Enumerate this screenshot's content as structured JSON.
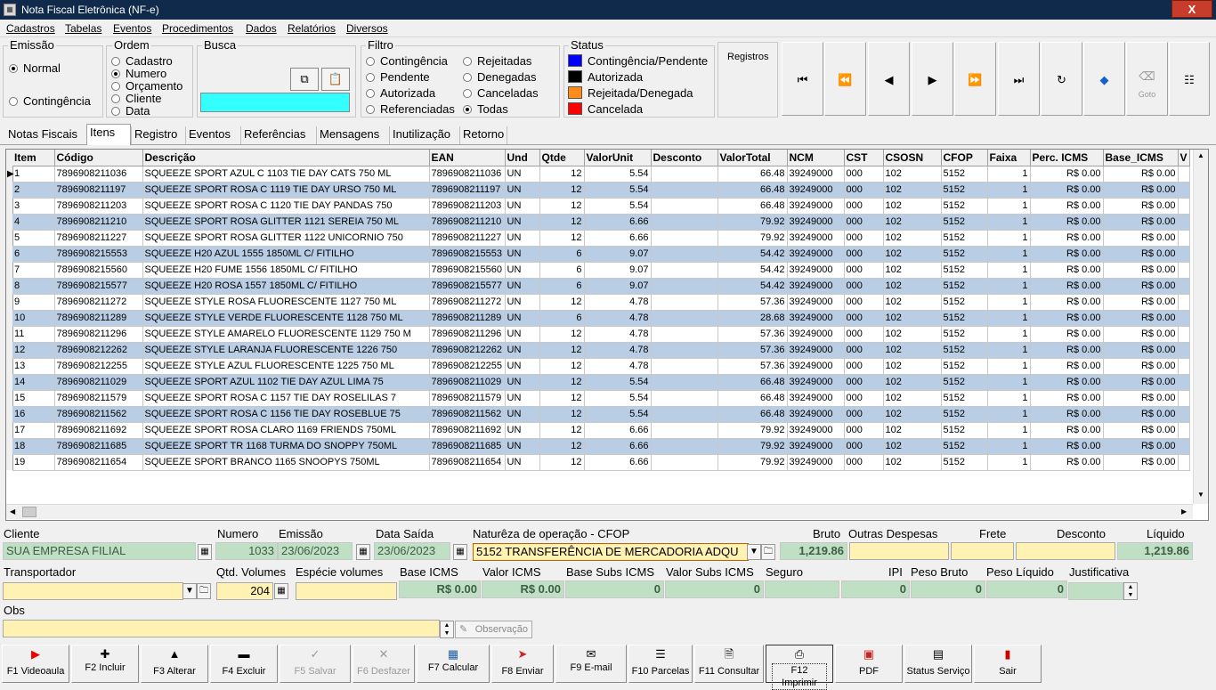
{
  "window": {
    "title": "Nota Fiscal Eletrônica (NF-e)",
    "close_glyph": "X",
    "min_glyph": "—",
    "max_glyph": "□"
  },
  "menu": [
    "Cadastros",
    "Tabelas",
    "Eventos",
    "Procedimentos",
    "Dados",
    "Relatórios",
    "Diversos"
  ],
  "emissao": {
    "label": "Emissão",
    "options": [
      "Normal",
      "Contingência"
    ],
    "selected": "Normal"
  },
  "ordem": {
    "label": "Ordem",
    "options": [
      "Cadastro",
      "Numero",
      "Orçamento",
      "Cliente",
      "Data"
    ],
    "selected": "Numero"
  },
  "busca": {
    "label": "Busca",
    "value": ""
  },
  "filtro": {
    "label": "Filtro",
    "options": [
      "Contingência",
      "Rejeitadas",
      "Pendente",
      "Denegadas",
      "Autorizada",
      "Canceladas",
      "Referenciadas",
      "Todas"
    ],
    "selected": "Todas"
  },
  "status": {
    "label": "Status",
    "items": [
      {
        "label": "Contingência/Pendente",
        "color": "#0000ff"
      },
      {
        "label": "Autorizada",
        "color": "#000000"
      },
      {
        "label": "Rejeitada/Denegada",
        "color": "#ff8c1a"
      },
      {
        "label": "Cancelada",
        "color": "#ff0000"
      }
    ]
  },
  "registros_label": "Registros",
  "toolbar_icons": [
    "first-icon",
    "prev-page-icon",
    "prev-icon",
    "next-icon",
    "next-page-icon",
    "last-icon",
    "refresh-icon",
    "bookmark-icon",
    "goto-icon",
    "list-icon"
  ],
  "toolbar_goto_label": "Goto",
  "tabs": [
    "Notas Fiscais",
    "Itens",
    "Registro",
    "Eventos",
    "Referências",
    "Mensagens",
    "Inutilização",
    "Retorno"
  ],
  "active_tab": "Itens",
  "grid": {
    "columns": [
      "Item",
      "Código",
      "Descrição",
      "EAN",
      "Und",
      "Qtde",
      "ValorUnit",
      "Desconto",
      "ValorTotal",
      "NCM",
      "CST",
      "CSOSN",
      "CFOP",
      "Faixa",
      "Perc. ICMS",
      "Base_ICMS",
      "V"
    ],
    "rows": [
      [
        "1",
        "7896908211036",
        "SQUEEZE SPORT AZUL C 1103 TIE DAY CATS 750 ML",
        "7896908211036",
        "UN",
        "12",
        "5.54",
        "",
        "66.48",
        "39249000",
        "000",
        "102",
        "5152",
        "1",
        "R$ 0.00",
        "R$ 0.00"
      ],
      [
        "2",
        "7896908211197",
        "SQUEEZE SPORT ROSA C 1119 TIE DAY URSO 750 ML",
        "7896908211197",
        "UN",
        "12",
        "5.54",
        "",
        "66.48",
        "39249000",
        "000",
        "102",
        "5152",
        "1",
        "R$ 0.00",
        "R$ 0.00"
      ],
      [
        "3",
        "7896908211203",
        "SQUEEZE SPORT ROSA C 1120 TIE DAY PANDAS 750",
        "7896908211203",
        "UN",
        "12",
        "5.54",
        "",
        "66.48",
        "39249000",
        "000",
        "102",
        "5152",
        "1",
        "R$ 0.00",
        "R$ 0.00"
      ],
      [
        "4",
        "7896908211210",
        "SQUEEZE SPORT ROSA GLITTER 1121 SEREIA 750 ML",
        "7896908211210",
        "UN",
        "12",
        "6.66",
        "",
        "79.92",
        "39249000",
        "000",
        "102",
        "5152",
        "1",
        "R$ 0.00",
        "R$ 0.00"
      ],
      [
        "5",
        "7896908211227",
        "SQUEEZE SPORT ROSA GLITTER 1122 UNICORNIO 750",
        "7896908211227",
        "UN",
        "12",
        "6.66",
        "",
        "79.92",
        "39249000",
        "000",
        "102",
        "5152",
        "1",
        "R$ 0.00",
        "R$ 0.00"
      ],
      [
        "6",
        "7896908215553",
        "SQUEEZE H20 AZUL 1555 1850ML C/ FITILHO",
        "7896908215553",
        "UN",
        "6",
        "9.07",
        "",
        "54.42",
        "39249000",
        "000",
        "102",
        "5152",
        "1",
        "R$ 0.00",
        "R$ 0.00"
      ],
      [
        "7",
        "7896908215560",
        "SQUEEZE H20 FUME 1556 1850ML C/ FITILHO",
        "7896908215560",
        "UN",
        "6",
        "9.07",
        "",
        "54.42",
        "39249000",
        "000",
        "102",
        "5152",
        "1",
        "R$ 0.00",
        "R$ 0.00"
      ],
      [
        "8",
        "7896908215577",
        "SQUEEZE H20 ROSA 1557 1850ML C/ FITILHO",
        "7896908215577",
        "UN",
        "6",
        "9.07",
        "",
        "54.42",
        "39249000",
        "000",
        "102",
        "5152",
        "1",
        "R$ 0.00",
        "R$ 0.00"
      ],
      [
        "9",
        "7896908211272",
        "SQUEEZE STYLE ROSA FLUORESCENTE 1127 750 ML",
        "7896908211272",
        "UN",
        "12",
        "4.78",
        "",
        "57.36",
        "39249000",
        "000",
        "102",
        "5152",
        "1",
        "R$ 0.00",
        "R$ 0.00"
      ],
      [
        "10",
        "7896908211289",
        "SQUEEZE STYLE VERDE FLUORESCENTE 1128 750 ML",
        "7896908211289",
        "UN",
        "6",
        "4.78",
        "",
        "28.68",
        "39249000",
        "000",
        "102",
        "5152",
        "1",
        "R$ 0.00",
        "R$ 0.00"
      ],
      [
        "11",
        "7896908211296",
        "SQUEEZE STYLE AMARELO FLUORESCENTE 1129 750 M",
        "7896908211296",
        "UN",
        "12",
        "4.78",
        "",
        "57.36",
        "39249000",
        "000",
        "102",
        "5152",
        "1",
        "R$ 0.00",
        "R$ 0.00"
      ],
      [
        "12",
        "7896908212262",
        "SQUEEZE STYLE LARANJA  FLUORESCENTE 1226 750",
        "7896908212262",
        "UN",
        "12",
        "4.78",
        "",
        "57.36",
        "39249000",
        "000",
        "102",
        "5152",
        "1",
        "R$ 0.00",
        "R$ 0.00"
      ],
      [
        "13",
        "7896908212255",
        "SQUEEZE STYLE AZUL FLUORESCENTE 1225 750 ML",
        "7896908212255",
        "UN",
        "12",
        "4.78",
        "",
        "57.36",
        "39249000",
        "000",
        "102",
        "5152",
        "1",
        "R$ 0.00",
        "R$ 0.00"
      ],
      [
        "14",
        "7896908211029",
        "SQUEEZE SPORT AZUL 1102 TIE DAY AZUL LIMA  75",
        "7896908211029",
        "UN",
        "12",
        "5.54",
        "",
        "66.48",
        "39249000",
        "000",
        "102",
        "5152",
        "1",
        "R$ 0.00",
        "R$ 0.00"
      ],
      [
        "15",
        "7896908211579",
        "SQUEEZE SPORT ROSA C 1157 TIE DAY ROSELILAS 7",
        "7896908211579",
        "UN",
        "12",
        "5.54",
        "",
        "66.48",
        "39249000",
        "000",
        "102",
        "5152",
        "1",
        "R$ 0.00",
        "R$ 0.00"
      ],
      [
        "16",
        "7896908211562",
        "SQUEEZE SPORT ROSA C 1156 TIE DAY ROSEBLUE 75",
        "7896908211562",
        "UN",
        "12",
        "5.54",
        "",
        "66.48",
        "39249000",
        "000",
        "102",
        "5152",
        "1",
        "R$ 0.00",
        "R$ 0.00"
      ],
      [
        "17",
        "7896908211692",
        "SQUEEZE SPORT ROSA CLARO 1169 FRIENDS 750ML",
        "7896908211692",
        "UN",
        "12",
        "6.66",
        "",
        "79.92",
        "39249000",
        "000",
        "102",
        "5152",
        "1",
        "R$ 0.00",
        "R$ 0.00"
      ],
      [
        "18",
        "7896908211685",
        "SQUEEZE SPORT TR 1168 TURMA DO SNOPPY 750ML",
        "7896908211685",
        "UN",
        "12",
        "6.66",
        "",
        "79.92",
        "39249000",
        "000",
        "102",
        "5152",
        "1",
        "R$ 0.00",
        "R$ 0.00"
      ],
      [
        "19",
        "7896908211654",
        "SQUEEZE SPORT BRANCO 1165 SNOOPYS 750ML",
        "7896908211654",
        "UN",
        "12",
        "6.66",
        "",
        "79.92",
        "39249000",
        "000",
        "102",
        "5152",
        "1",
        "R$ 0.00",
        "R$ 0.00"
      ]
    ]
  },
  "form": {
    "cliente_label": "Cliente",
    "cliente": "SUA EMPRESA FILIAL",
    "numero_label": "Numero",
    "numero": "1033",
    "emissao_label": "Emissão",
    "emissao": "23/06/2023",
    "data_saida_label": "Data Saída",
    "data_saida": "23/06/2023",
    "natureza_label": "Naturêza de operação - CFOP",
    "natureza": "5152 TRANSFERÊNCIA DE MERCADORIA ADQU",
    "bruto_label": "Bruto",
    "bruto": "1,219.86",
    "outras_label": "Outras Despesas",
    "outras": "",
    "frete_label": "Frete",
    "frete": "",
    "desconto_label": "Desconto",
    "desconto": "",
    "liquido_label": "Líquido",
    "liquido": "1,219.86",
    "transportador_label": "Transportador",
    "transportador": "",
    "qtd_volumes_label": "Qtd. Volumes",
    "qtd_volumes": "204",
    "especie_label": "Espécie volumes",
    "especie": "",
    "base_icms_label": "Base ICMS",
    "base_icms": "R$ 0.00",
    "valor_icms_label": "Valor ICMS",
    "valor_icms": "R$ 0.00",
    "base_subs_label": "Base Subs ICMS",
    "base_subs": "0",
    "valor_subs_label": "Valor Subs ICMS",
    "valor_subs": "0",
    "seguro_label": "Seguro",
    "seguro": "",
    "ipi_label": "IPI",
    "ipi": "0",
    "peso_bruto_label": "Peso Bruto",
    "peso_bruto": "0",
    "peso_liquido_label": "Peso Líquido",
    "peso_liquido": "0",
    "justificativa_label": "Justificativa",
    "justificativa": "",
    "obs_label": "Obs",
    "obs": "",
    "observacao_button": "Observação"
  },
  "bottom_buttons": [
    {
      "label": "F1 Videoaula",
      "icon": "youtube-icon"
    },
    {
      "label": "F2 Incluir",
      "icon": "plus-icon"
    },
    {
      "label": "F3 Alterar",
      "icon": "up-arrow-icon"
    },
    {
      "label": "F4 Excluir",
      "icon": "minus-icon"
    },
    {
      "label": "F5 Salvar",
      "icon": "check-icon"
    },
    {
      "label": "F6 Desfazer",
      "icon": "x-icon"
    },
    {
      "label": "F7 Calcular",
      "icon": "calculator-icon"
    },
    {
      "label": "F8 Enviar",
      "icon": "send-icon"
    },
    {
      "label": "F9 E-mail",
      "icon": "mail-icon"
    },
    {
      "label": "F10 Parcelas",
      "icon": "list-icon"
    },
    {
      "label": "F11 Consultar",
      "icon": "search-doc-icon"
    },
    {
      "label": "F12 Imprimir",
      "icon": "printer-icon"
    },
    {
      "label": "PDF",
      "icon": "pdf-icon"
    },
    {
      "label": "Status Serviço",
      "icon": "status-icon"
    },
    {
      "label": "Sair",
      "icon": "exit-icon"
    }
  ]
}
